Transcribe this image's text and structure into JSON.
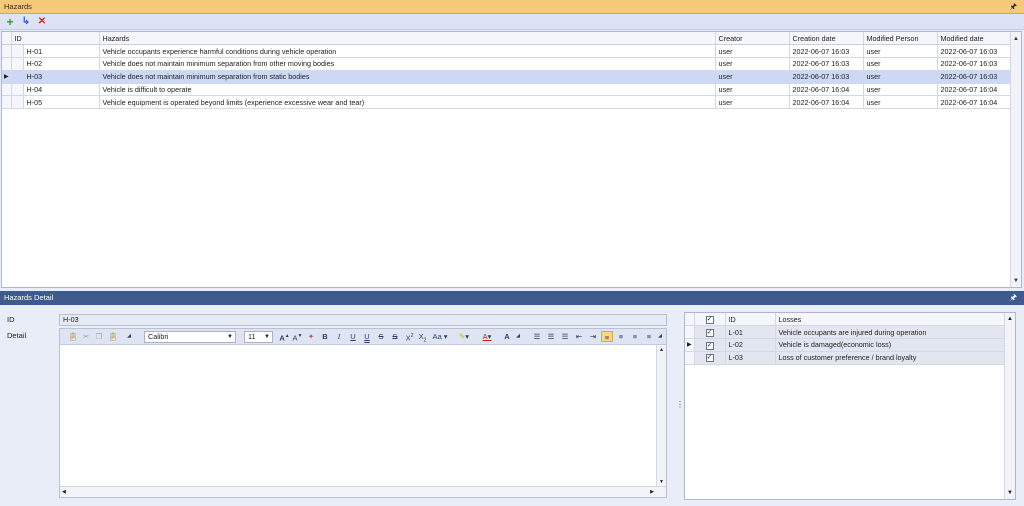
{
  "hazards_panel": {
    "title": "Hazards",
    "toolbar": {
      "add_icon": "plus-icon",
      "link_icon": "arrow-turn-icon",
      "delete_icon": "x-icon"
    },
    "columns": [
      "ID",
      "Hazards",
      "Creator",
      "Creation date",
      "Modified Person",
      "Modified date"
    ],
    "rows": [
      {
        "id": "H-01",
        "hazard": "Vehicle occupants experience harmful conditions during vehicle operation",
        "creator": "user",
        "created": "2022-06-07 16:03",
        "modified_by": "user",
        "modified": "2022-06-07 16:03"
      },
      {
        "id": "H-02",
        "hazard": "Vehicle does not maintain minimum separation from other moving bodies",
        "creator": "user",
        "created": "2022-06-07 16:03",
        "modified_by": "user",
        "modified": "2022-06-07 16:03"
      },
      {
        "id": "H-03",
        "hazard": "Vehicle does not maintain minimum separation from static bodies",
        "creator": "user",
        "created": "2022-06-07 16:03",
        "modified_by": "user",
        "modified": "2022-06-07 16:03"
      },
      {
        "id": "H-04",
        "hazard": "Vehicle is difficult to operate",
        "creator": "user",
        "created": "2022-06-07 16:04",
        "modified_by": "user",
        "modified": "2022-06-07 16:04"
      },
      {
        "id": "H-05",
        "hazard": "Vehicle equipment is operated beyond limits (experience excessive wear and tear)",
        "creator": "user",
        "created": "2022-06-07 16:04",
        "modified_by": "user",
        "modified": "2022-06-07 16:04"
      }
    ],
    "selected_row": "H-03"
  },
  "detail_panel": {
    "title": "Hazards Detail",
    "id_label": "ID",
    "id_value": "H-03",
    "detail_label": "Detail",
    "font_name": "Calibri",
    "font_size": "11"
  },
  "losses": {
    "columns": [
      "ID",
      "Losses"
    ],
    "rows": [
      {
        "checked": true,
        "id": "L-01",
        "loss": "Vehicle occupants are injured during operation"
      },
      {
        "checked": true,
        "id": "L-02",
        "loss": "Vehicle is damaged(economic loss)"
      },
      {
        "checked": true,
        "id": "L-03",
        "loss": "Loss of customer preference / brand loyalty"
      }
    ]
  },
  "colors": {
    "top_title_bg": "#f6c87a",
    "bottom_title_bg": "#3f5a8e",
    "selected_row": "#ccd8f5"
  }
}
